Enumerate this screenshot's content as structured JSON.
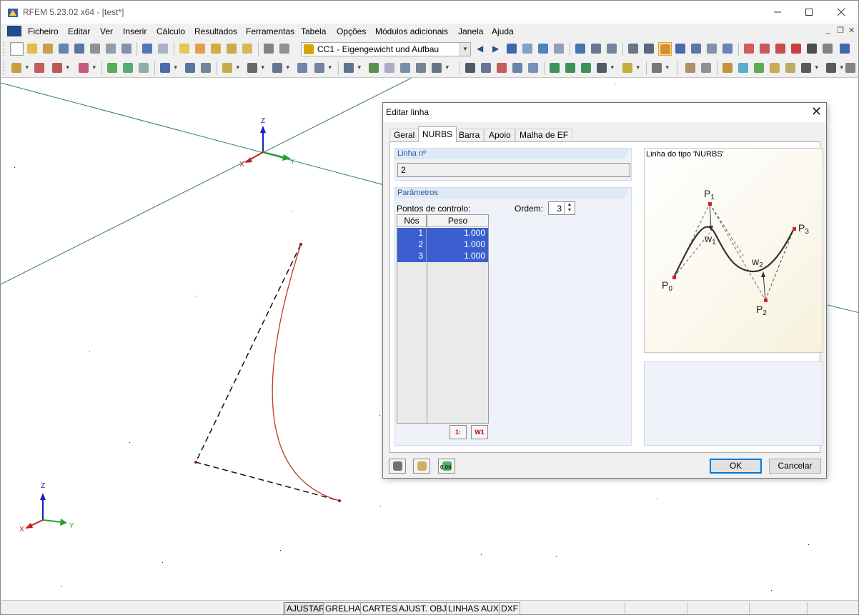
{
  "window": {
    "title": "RFEM 5.23.02 x64 - [test*]"
  },
  "menu": {
    "items": [
      "Ficheiro",
      "Editar",
      "Ver",
      "Inserir",
      "Cálculo",
      "Resultados",
      "Ferramentas",
      "Tabela",
      "Opções",
      "Módulos adicionais",
      "Janela",
      "Ajuda"
    ]
  },
  "toolbar": {
    "load_case": "CC1 - Eigengewicht und Aufbau"
  },
  "workspace": {
    "axis_labels_main": {
      "z": "Z",
      "x": "X",
      "y": "Y"
    },
    "axis_labels_corner": {
      "z": "Z",
      "x": "X",
      "y": "Y"
    },
    "colors": {
      "curve": "#c0392b",
      "grid_lines": "#2e7d6b",
      "control_polygon": "#111111"
    }
  },
  "statusbar": {
    "buttons": [
      "AJUSTAR",
      "GRELHA",
      "CARTES",
      "AJUST. OBJ.",
      "LINHAS AUX.",
      "DXF"
    ]
  },
  "dialog": {
    "title": "Editar linha",
    "tabs": [
      "Geral",
      "NURBS",
      "Barra",
      "Apoio",
      "Malha de EF"
    ],
    "active_tab": "NURBS",
    "line_number": {
      "label": "Linha nº",
      "value": "2"
    },
    "parameters": {
      "label": "Parâmetros",
      "control_points_label": "Pontos de controlo:",
      "order_label": "Ordem:",
      "order_value": "3",
      "columns": [
        "Nós",
        "Peso"
      ],
      "rows": [
        {
          "node": "1",
          "weight": "1.000"
        },
        {
          "node": "2",
          "weight": "1.000"
        },
        {
          "node": "3",
          "weight": "1.000"
        }
      ],
      "btn_sort": "1:",
      "btn_weights": "W1"
    },
    "preview": {
      "caption": "Linha do tipo 'NURBS'",
      "labels": {
        "p0": "P",
        "p0_sub": "0",
        "p1": "P",
        "p1_sub": "1",
        "p2": "P",
        "p2_sub": "2",
        "p3": "P",
        "p3_sub": "3",
        "w1": "w",
        "w1_sub": "1",
        "w2": "w",
        "w2_sub": "2"
      }
    },
    "buttons": {
      "ok": "OK",
      "cancel": "Cancelar",
      "num_button": "0.00"
    }
  }
}
